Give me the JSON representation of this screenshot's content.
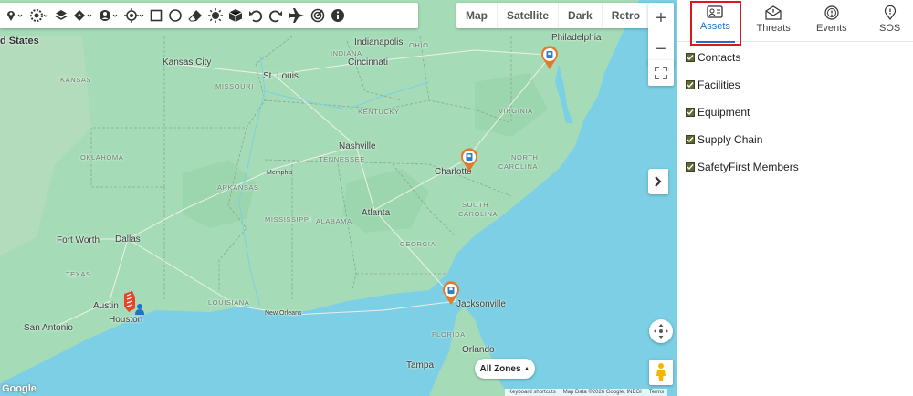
{
  "toolbar": {
    "tools": [
      {
        "name": "marker-tool-icon"
      },
      {
        "name": "settings-tool-icon"
      },
      {
        "name": "layers-tool-icon"
      },
      {
        "name": "direction-tool-icon"
      },
      {
        "name": "person-tool-icon"
      },
      {
        "name": "locate-tool-icon"
      },
      {
        "name": "rectangle-tool-icon"
      },
      {
        "name": "circle-tool-icon"
      },
      {
        "name": "eraser-tool-icon"
      },
      {
        "name": "weather-tool-icon"
      },
      {
        "name": "cube-tool-icon"
      },
      {
        "name": "undo-icon"
      },
      {
        "name": "redo-icon"
      },
      {
        "name": "airplane-icon"
      },
      {
        "name": "radar-icon"
      },
      {
        "name": "info-icon"
      }
    ]
  },
  "map_type": {
    "options": [
      "Map",
      "Satellite",
      "Dark",
      "Retro"
    ]
  },
  "zoom": {
    "in": "+",
    "out": "−"
  },
  "zones_label": "All Zones",
  "attribution": {
    "shortcuts": "Keyboard shortcuts",
    "data": "Map Data ©2026 Google, INEGI",
    "terms": "Terms"
  },
  "google_logo": "Google",
  "map_labels": {
    "cities": {
      "united_states": "d States",
      "indianapolis": "Indianapolis",
      "philadelphia": "Philadelphia",
      "kansas_city": "Kansas City",
      "cincinnati": "Cincinnati",
      "st_louis": "St. Louis",
      "nashville": "Nashville",
      "memphis": "Memphis",
      "charlotte": "Charlotte",
      "atlanta": "Atlanta",
      "fort_worth": "Fort Worth",
      "dallas": "Dallas",
      "austin": "Austin",
      "houston": "Houston",
      "san_antonio": "San Antonio",
      "new_orleans": "New Orleans",
      "jacksonville": "Jacksonville",
      "orlando": "Orlando",
      "tampa": "Tampa"
    },
    "states": {
      "indiana": "INDIANA",
      "ohio": "OHIO",
      "kansas": "KANSAS",
      "missouri": "MISSOURI",
      "kentucky": "KENTUCKY",
      "virginia": "VIRGINIA",
      "tennessee": "TENNESSEE",
      "oklahoma": "OKLAHOMA",
      "arkansas": "ARKANSAS",
      "north_carolina_1": "NORTH",
      "north_carolina_2": "CAROLINA",
      "south_carolina_1": "SOUTH",
      "south_carolina_2": "CAROLINA",
      "mississippi": "MISSISSIPPI",
      "alabama": "ALABAMA",
      "georgia": "GEORGIA",
      "louisiana": "LOUISIANA",
      "texas": "TEXAS",
      "florida": "FLORIDA"
    }
  },
  "panel": {
    "tabs": [
      {
        "label": "Assets",
        "active": true
      },
      {
        "label": "Threats",
        "active": false
      },
      {
        "label": "Events",
        "active": false
      },
      {
        "label": "SOS",
        "active": false
      }
    ],
    "checkboxes": [
      {
        "label": "Contacts",
        "checked": true
      },
      {
        "label": "Facilities",
        "checked": true
      },
      {
        "label": "Equipment",
        "checked": true
      },
      {
        "label": "Supply Chain",
        "checked": true
      },
      {
        "label": "SafetyFirst Members",
        "checked": true
      }
    ]
  },
  "colors": {
    "land": "#a5dcb7",
    "water": "#7ccfe4",
    "pin": "#e2792d",
    "active_tab": "#1a73c8",
    "highlight": "#d8191e",
    "checkbox": "#5f6b32"
  }
}
